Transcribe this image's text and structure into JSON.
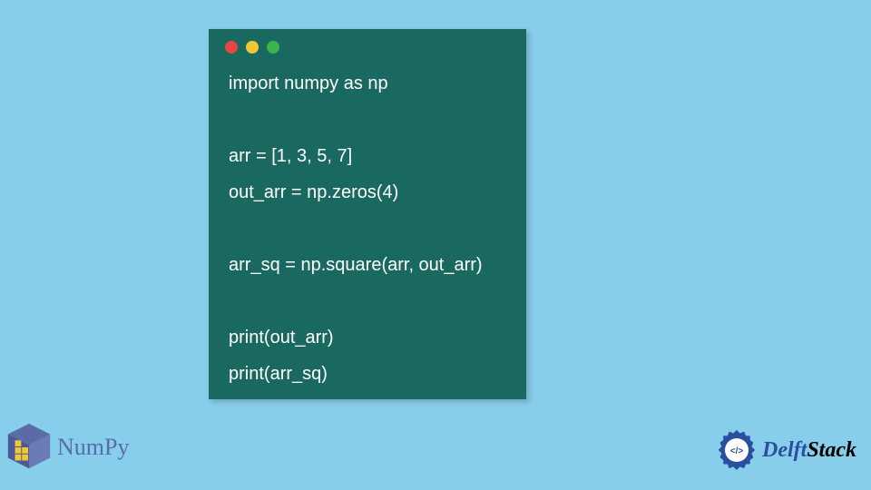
{
  "code": {
    "line1": "import numpy as np",
    "blank1": "",
    "line2": "arr = [1, 3, 5, 7]",
    "line3": "out_arr = np.zeros(4)",
    "blank2": "",
    "line4": "arr_sq = np.square(arr, out_arr)",
    "blank3": "",
    "line5": "print(out_arr)",
    "line6": "print(arr_sq)"
  },
  "logos": {
    "numpy": "NumPy",
    "delft_prefix": "Delft",
    "delft_suffix": "Stack",
    "delft_code": "</>"
  }
}
